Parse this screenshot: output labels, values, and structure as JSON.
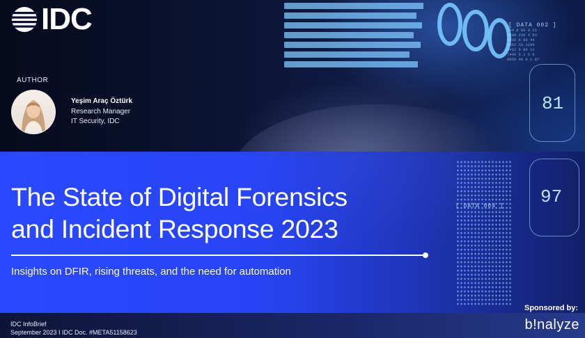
{
  "brand": {
    "logo_text": "IDC"
  },
  "author": {
    "section_label": "AUTHOR",
    "name": "Yeşim Araç Öztürk",
    "role": "Research Manager",
    "department": "IT Security, IDC"
  },
  "report": {
    "title_line1": "The State of Digital Forensics",
    "title_line2": "and Incident Response 2023",
    "subtitle": "Insights on DFIR, rising threats, and the need for automation"
  },
  "sponsor": {
    "label": "Sponsored by:",
    "name": "b!nalyze"
  },
  "footer": {
    "doc_type": "IDC InfoBrief",
    "doc_info": "September 2023 I IDC Doc. #META51158623"
  },
  "background_hud": {
    "labels": [
      "[ DATA 002 ]",
      "[ DATA 004 ]"
    ],
    "numbers": [
      "81",
      "97"
    ]
  },
  "colors": {
    "band": "#2a48ff",
    "background": "#0a1030",
    "text": "#ffffff"
  }
}
